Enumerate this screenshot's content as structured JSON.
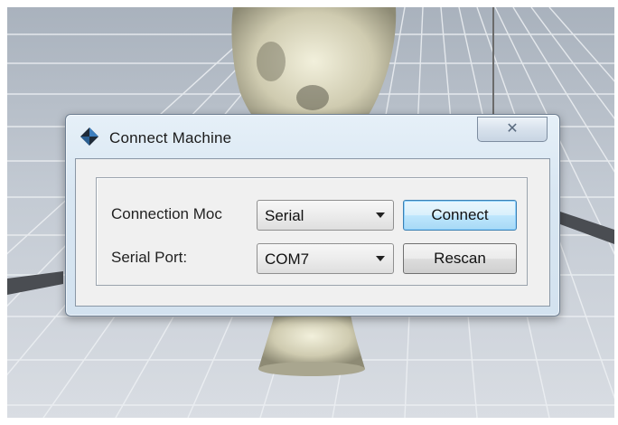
{
  "dialog": {
    "title": "Connect Machine",
    "close_glyph": "✕",
    "icon": "diamond-app-icon"
  },
  "form": {
    "connection_mode": {
      "label": "Connection Moc",
      "value": "Serial"
    },
    "serial_port": {
      "label": "Serial Port:",
      "value": "COM7"
    },
    "connect_label": "Connect",
    "rescan_label": "Rescan"
  },
  "colors": {
    "grid_line": "#eef1f4",
    "build_plate": "#c0c8d2",
    "model": "#d8d6c0",
    "accent_button": "#bee6fd"
  }
}
